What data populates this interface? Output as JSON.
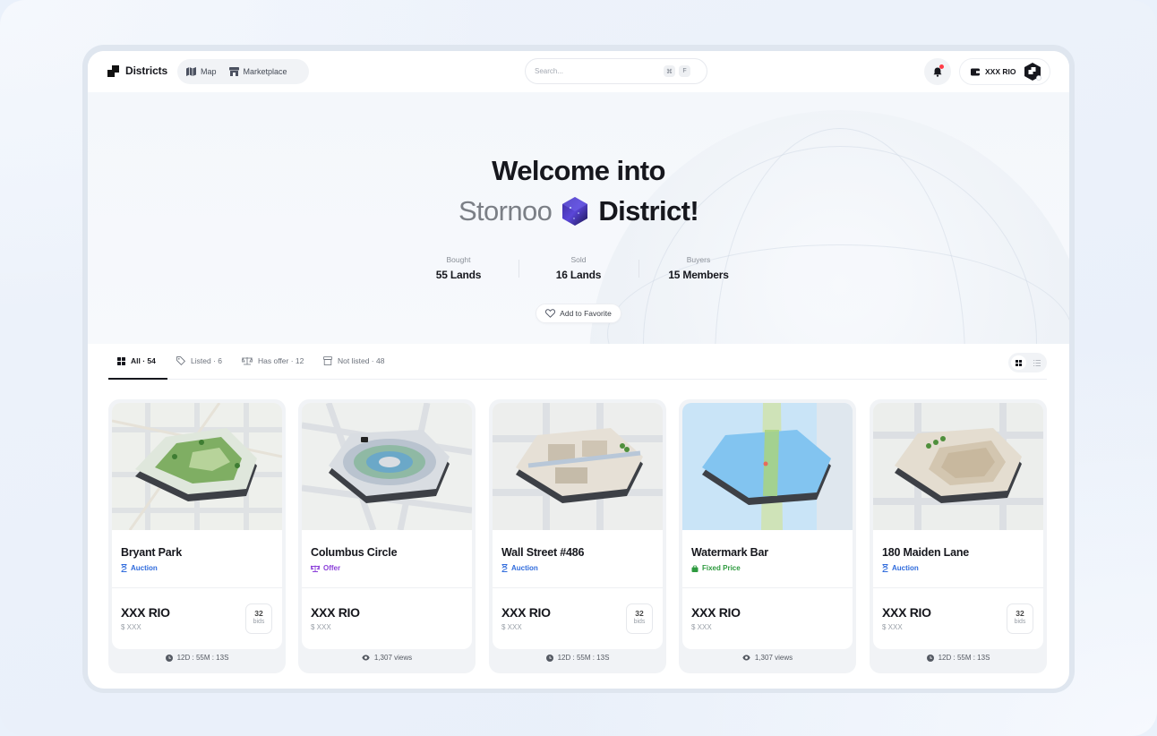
{
  "app": {
    "logo_text": "Districts",
    "nav": [
      {
        "label": "Map",
        "icon": "map-icon"
      },
      {
        "label": "Marketplace",
        "icon": "store-icon"
      }
    ],
    "search": {
      "placeholder": "Search...",
      "shortcut_keys": [
        "⌘",
        "F"
      ]
    },
    "wallet_label": "XXX RIO",
    "accent": "#2f6bdc"
  },
  "hero": {
    "title_line1": "Welcome into",
    "title_name": "Stornoo",
    "title_suffix": "District!",
    "stats": [
      {
        "label": "Bought",
        "value": "55 Lands"
      },
      {
        "label": "Sold",
        "value": "16 Lands"
      },
      {
        "label": "Buyers",
        "value": "15 Members"
      }
    ],
    "favorite_label": "Add to Favorite"
  },
  "tabs": [
    {
      "label": "All · 54",
      "icon": "grid-icon",
      "active": true
    },
    {
      "label": "Listed · 6",
      "icon": "tag-icon",
      "active": false
    },
    {
      "label": "Has offer · 12",
      "icon": "scale-icon",
      "active": false
    },
    {
      "label": "Not listed · 48",
      "icon": "store-icon",
      "active": false
    }
  ],
  "cards": [
    {
      "name": "Bryant Park",
      "type": "Auction",
      "type_color": "#2f6bdc",
      "price": "XXX RIO",
      "usd": "$ XXX",
      "bids": "32",
      "bids_label": "bids",
      "footer": "12D : 55M : 13S",
      "footer_icon": "clock-icon"
    },
    {
      "name": "Columbus Circle",
      "type": "Offer",
      "type_color": "#8b3fd9",
      "price": "XXX RIO",
      "usd": "$ XXX",
      "bids": "",
      "bids_label": "",
      "footer": "1,307 views",
      "footer_icon": "eye-icon"
    },
    {
      "name": "Wall Street #486",
      "type": "Auction",
      "type_color": "#2f6bdc",
      "price": "XXX RIO",
      "usd": "$ XXX",
      "bids": "32",
      "bids_label": "bids",
      "footer": "12D : 55M : 13S",
      "footer_icon": "clock-icon"
    },
    {
      "name": "Watermark Bar",
      "type": "Fixed Price",
      "type_color": "#2e9a3f",
      "price": "XXX RIO",
      "usd": "$ XXX",
      "bids": "",
      "bids_label": "",
      "footer": "1,307 views",
      "footer_icon": "eye-icon"
    },
    {
      "name": "180 Maiden Lane",
      "type": "Auction",
      "type_color": "#2f6bdc",
      "price": "XXX RIO",
      "usd": "$ XXX",
      "bids": "32",
      "bids_label": "bids",
      "footer": "12D : 55M : 13S",
      "footer_icon": "clock-icon"
    }
  ]
}
